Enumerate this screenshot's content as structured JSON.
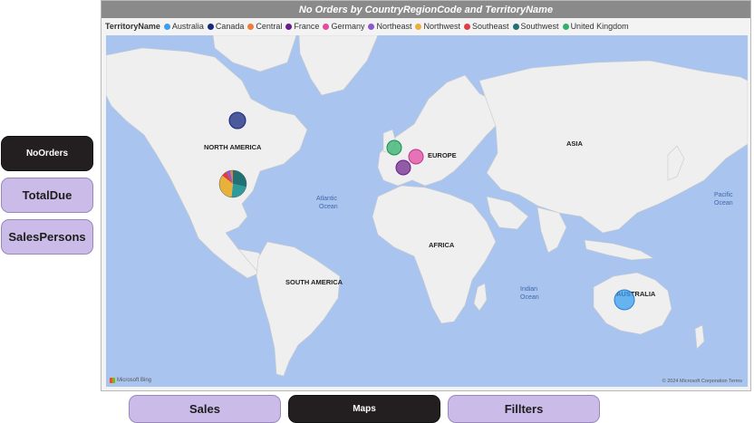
{
  "side_buttons": {
    "noorders": "NoOrders",
    "totaldue": "TotalDue",
    "salespersons": "SalesPersons"
  },
  "bottom_buttons": {
    "sales": "Sales",
    "maps": "Maps",
    "filters": "Fillters"
  },
  "visual": {
    "title": "No Orders by CountryRegionCode and TerritoryName",
    "legend_title": "TerritoryName",
    "legend": [
      {
        "name": "Australia",
        "color": "#3a9ff0"
      },
      {
        "name": "Canada",
        "color": "#16277e"
      },
      {
        "name": "Central",
        "color": "#ec7d3b"
      },
      {
        "name": "France",
        "color": "#6b1c8a"
      },
      {
        "name": "Germany",
        "color": "#e44aa4"
      },
      {
        "name": "Northeast",
        "color": "#8a5ad0"
      },
      {
        "name": "Northwest",
        "color": "#e8b23a"
      },
      {
        "name": "Southeast",
        "color": "#de3e43"
      },
      {
        "name": "Southwest",
        "color": "#1f7173"
      },
      {
        "name": "United Kingdom",
        "color": "#2fb26b"
      }
    ]
  },
  "map": {
    "continents": {
      "north_america": "NORTH AMERICA",
      "europe": "EUROPE",
      "asia": "ASIA",
      "africa": "AFRICA",
      "south_america": "SOUTH AMERICA",
      "australia": "AUSTRALIA"
    },
    "oceans": {
      "atlantic_1": "Atlantic",
      "atlantic_2": "Ocean",
      "pacific_1": "Pacific",
      "pacific_2": "Ocean",
      "indian_1": "Indian",
      "indian_2": "Ocean"
    },
    "attribution": "Microsoft Bing",
    "copyright": "© 2024 Microsoft Corporation  Terms"
  }
}
